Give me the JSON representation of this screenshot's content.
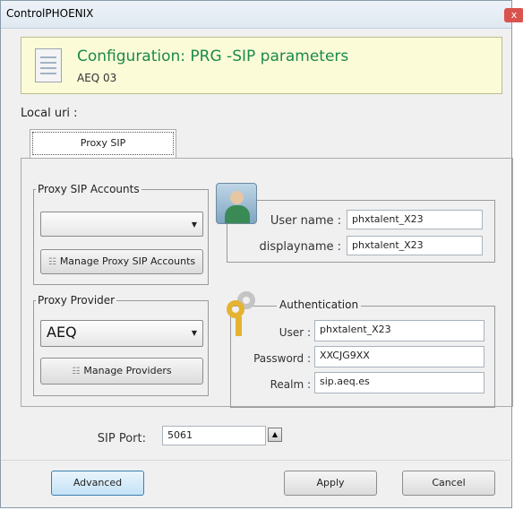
{
  "window": {
    "title": "ControlPHOENIX",
    "close": "x"
  },
  "header": {
    "title": "Configuration: PRG -SIP parameters",
    "subtitle": "AEQ 03",
    "icon": "document-icon"
  },
  "local_uri": {
    "label": "Local uri :"
  },
  "tabs": [
    {
      "label": "Proxy SIP",
      "selected": true
    }
  ],
  "proxy_accounts": {
    "legend": "Proxy SIP Accounts",
    "selected": "",
    "manage_button": "Manage Proxy SIP Accounts",
    "manage_icon": "list-icon"
  },
  "user": {
    "icon": "user-avatar-icon",
    "username_label": "User name :",
    "username_value": "phxtalent_X23",
    "displayname_label": "displayname :",
    "displayname_value": "phxtalent_X23"
  },
  "proxy_provider": {
    "legend": "Proxy Provider",
    "selected": "AEQ",
    "manage_button": "Manage Providers",
    "manage_icon": "list-icon"
  },
  "authentication": {
    "icon": "keys-icon",
    "legend": "Authentication",
    "user_label": "User :",
    "user_value": "phxtalent_X23",
    "password_label": "Password :",
    "password_value": "XXCJG9XX",
    "realm_label": "Realm :",
    "realm_value": "sip.aeq.es"
  },
  "sip_port": {
    "label": "SIP Port:",
    "value": "5061"
  },
  "buttons": {
    "advanced": "Advanced",
    "apply": "Apply",
    "cancel": "Cancel"
  },
  "colors": {
    "header_bg": "#fcfbd8",
    "header_title": "#1b8a4a",
    "key_gold": "#e5b330"
  }
}
